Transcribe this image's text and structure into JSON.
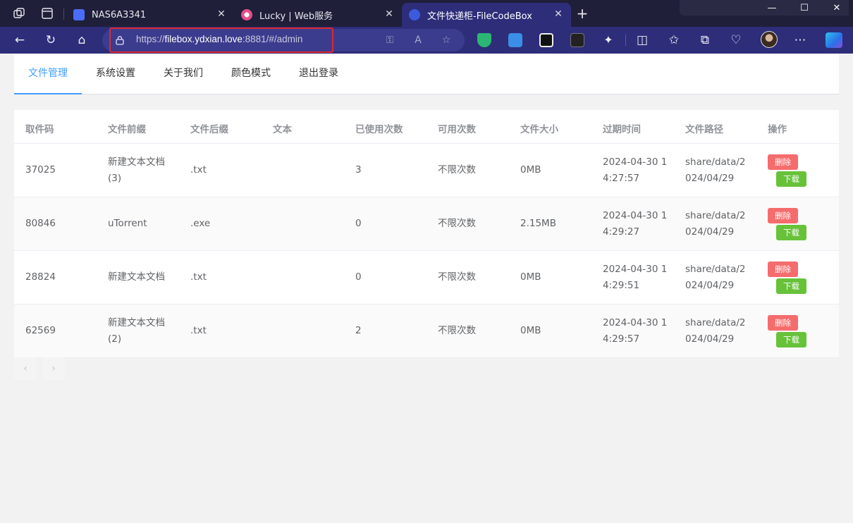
{
  "browser": {
    "tabs": [
      {
        "title": "NAS6A3341",
        "favicon_color": "#4a6cf7"
      },
      {
        "title": "Lucky | Web服务",
        "favicon_color": "#e84d8a"
      },
      {
        "title": "文件快递柜-FileCodeBox",
        "favicon_color": "#3b5bdb"
      }
    ],
    "close_glyph": "✕",
    "new_tab_glyph": "+",
    "window": {
      "minimize": "—",
      "maximize": "☐",
      "close": "✕"
    },
    "address": {
      "prefix": "https://",
      "host": "filebox.ydxian.love",
      "rest": ":8881/#/admin"
    },
    "nav_glyphs": {
      "back": "←",
      "refresh": "↻",
      "home": "⌂"
    },
    "address_icons": {
      "key": "⚿",
      "read_aloud": "A",
      "favorite": "☆"
    },
    "toolbar_glyphs": {
      "split": "◫",
      "favorites": "✩",
      "collections": "⧉",
      "health": "♡",
      "more": "⋯"
    },
    "accent_color": "#409eff"
  },
  "menu": {
    "items": [
      "文件管理",
      "系统设置",
      "关于我们",
      "颜色模式",
      "退出登录"
    ],
    "active_index": 0
  },
  "table": {
    "headers": [
      "取件码",
      "文件前缀",
      "文件后缀",
      "文本",
      "已使用次数",
      "可用次数",
      "文件大小",
      "过期时间",
      "文件路径",
      "操作"
    ],
    "rows": [
      {
        "code": "37025",
        "prefix_l1": "新建文本文档",
        "prefix_l2": "(3)",
        "suffix": ".txt",
        "text": "",
        "used": "3",
        "avail": "不限次数",
        "size": "0MB",
        "exp_l1": "2024-04-30 1",
        "exp_l2": "4:27:57",
        "path_l1": "share/data/2",
        "path_l2": "024/04/29"
      },
      {
        "code": "80846",
        "prefix_l1": "uTorrent",
        "prefix_l2": "",
        "suffix": ".exe",
        "text": "",
        "used": "0",
        "avail": "不限次数",
        "size": "2.15MB",
        "exp_l1": "2024-04-30 1",
        "exp_l2": "4:29:27",
        "path_l1": "share/data/2",
        "path_l2": "024/04/29"
      },
      {
        "code": "28824",
        "prefix_l1": "新建文本文档",
        "prefix_l2": "",
        "suffix": ".txt",
        "text": "",
        "used": "0",
        "avail": "不限次数",
        "size": "0MB",
        "exp_l1": "2024-04-30 1",
        "exp_l2": "4:29:51",
        "path_l1": "share/data/2",
        "path_l2": "024/04/29"
      },
      {
        "code": "62569",
        "prefix_l1": "新建文本文档",
        "prefix_l2": "(2)",
        "suffix": ".txt",
        "text": "",
        "used": "2",
        "avail": "不限次数",
        "size": "0MB",
        "exp_l1": "2024-04-30 1",
        "exp_l2": "4:29:57",
        "path_l1": "share/data/2",
        "path_l2": "024/04/29"
      }
    ],
    "delete_label": "删除",
    "download_label": "下载"
  },
  "pagination": {
    "prev": "‹",
    "next": "›"
  }
}
